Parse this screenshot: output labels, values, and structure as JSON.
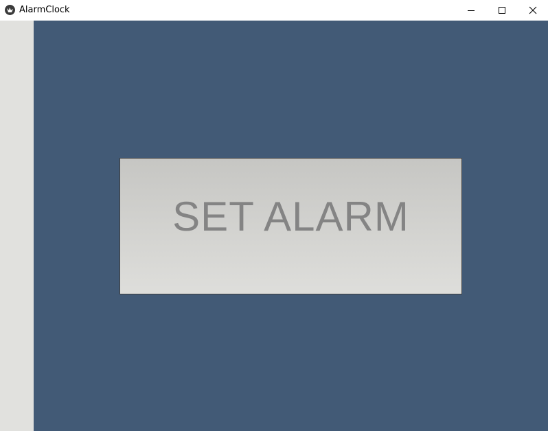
{
  "window": {
    "title": "AlarmClock",
    "app_icon": "kivy-app-icon",
    "controls": {
      "minimize_icon": "minimize-icon",
      "maximize_icon": "maximize-icon",
      "close_icon": "close-icon"
    }
  },
  "main": {
    "button_label": "SET ALARM"
  },
  "colors": {
    "content_background": "#425a76",
    "left_strip": "#e1e1de",
    "button_top": "#c6c6c3",
    "button_bottom": "#dededb",
    "button_text": "#848484"
  }
}
